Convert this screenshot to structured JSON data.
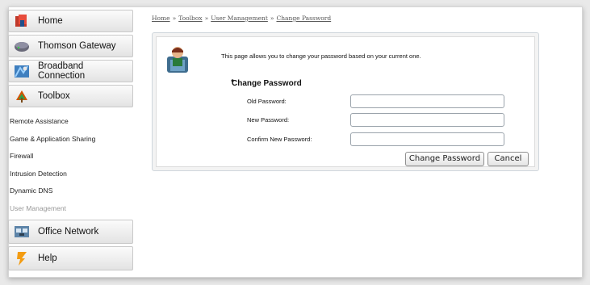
{
  "sidebar": {
    "items": [
      {
        "label": "Home",
        "icon": "home-icon"
      },
      {
        "label": "Thomson Gateway",
        "icon": "gateway-icon"
      },
      {
        "label": "Broadband Connection",
        "icon": "broadband-icon"
      },
      {
        "label": "Toolbox",
        "icon": "toolbox-icon"
      },
      {
        "label": "Office Network",
        "icon": "office-network-icon"
      },
      {
        "label": "Help",
        "icon": "help-icon"
      }
    ],
    "toolbox_sub": [
      "Remote Assistance",
      "Game & Application Sharing",
      "Firewall",
      "Intrusion Detection",
      "Dynamic DNS",
      "User Management"
    ]
  },
  "breadcrumb": [
    "Home",
    "Toolbox",
    "User Management",
    "Change Password"
  ],
  "main": {
    "intro": "This page allows you to change your password based on your current one.",
    "section_title": "Change Password",
    "fields": {
      "old": {
        "label": "Old Password:",
        "value": ""
      },
      "new": {
        "label": "New Password:",
        "value": ""
      },
      "confirm": {
        "label": "Confirm New Password:",
        "value": ""
      }
    },
    "buttons": {
      "change": "Change Password",
      "cancel": "Cancel"
    }
  },
  "colors": {
    "accent": "#5a8fc0",
    "panel_border": "#cfd6dc"
  }
}
